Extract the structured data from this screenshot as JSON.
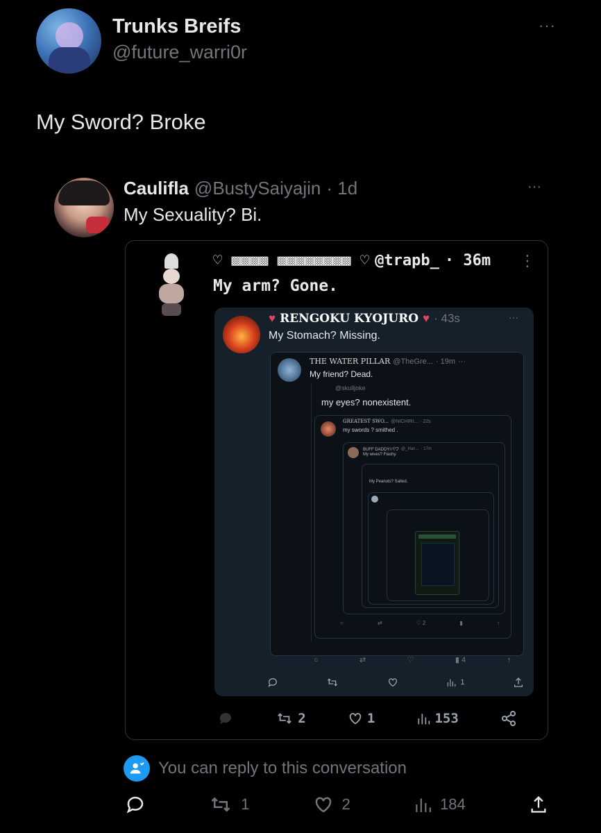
{
  "main_post": {
    "display_name": "Trunks Breifs",
    "handle": "@future_warri0r",
    "text": "My Sword? Broke",
    "more": "···"
  },
  "quoted": {
    "display_name": "Caulifla",
    "handle": "@BustySaiyajin",
    "time": "· 1d",
    "text": "My Sexuality? Bi.",
    "more": "···"
  },
  "nested1": {
    "name": "♡ ▩▩▩▩ ▩▩▩▩▩▩▩▩ ♡",
    "handle": "@trapb_",
    "time": "· 36m",
    "menu": "⋮",
    "text": "My arm? Gone.",
    "actions": {
      "reposts": "2",
      "likes": "1",
      "views": "153"
    }
  },
  "nested2": {
    "name": "RENGOKU KYOJURO",
    "time": "· 43s",
    "text": "My Stomach? Missing.",
    "more": "···",
    "actions": {
      "views": "1"
    }
  },
  "nested3": {
    "name": "THE WATER PILLAR",
    "handle": "@TheGre...",
    "time": "· 19m",
    "text": "My friend? Dead.",
    "more": "···",
    "actions": {
      "views": "4"
    }
  },
  "nested4": {
    "handle": "@skulljoke",
    "text": "my eyes? nonexistent."
  },
  "nested5": {
    "name": "GREATEST SWO...",
    "handle": "@NICHIRI...",
    "time": "· 22s",
    "text": "my swords ? smithed .",
    "actions": {
      "views": "2"
    }
  },
  "nested6": {
    "name": "BUFF DADDY/パワ",
    "handle": "@_Han...",
    "time": "· 17m",
    "text": "My wives? Flashy."
  },
  "nested7": {
    "text": "My Peanuts? Salted."
  },
  "reply_notice": {
    "text": "You can reply to this conversation"
  },
  "action_bar": {
    "reposts": "1",
    "likes": "2",
    "views": "184"
  }
}
